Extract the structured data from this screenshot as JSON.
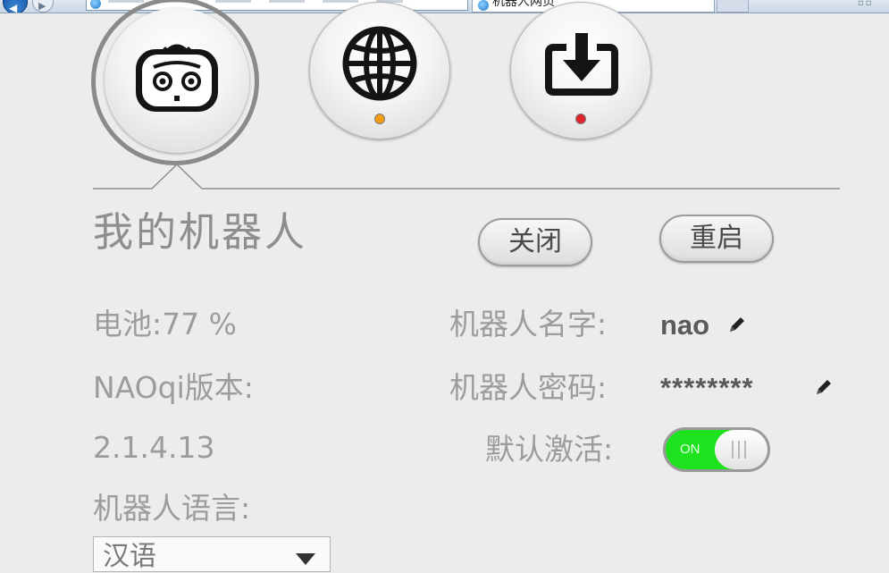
{
  "browser": {
    "tab_title": "机器人网页"
  },
  "nav": {
    "robot": {
      "icon": "robot-face-icon",
      "selected": true
    },
    "network": {
      "icon": "globe-icon",
      "status_color": "#f39c12"
    },
    "update": {
      "icon": "download-icon",
      "status_color": "#e0242a"
    }
  },
  "page": {
    "title": "我的机器人",
    "shutdown_label": "关闭",
    "restart_label": "重启"
  },
  "info": {
    "battery_label": "电池:",
    "battery_value": "77 %",
    "naoqi_label": "NAOqi版本:",
    "naoqi_value": "2.1.4.13",
    "language_label": "机器人语言:",
    "language_value": "汉语"
  },
  "settings": {
    "name_label": "机器人名字:",
    "name_value": "nao",
    "password_label": "机器人密码:",
    "password_value": "********",
    "autostart_label": "默认激活:",
    "autostart_state": "ON"
  },
  "colors": {
    "toggle_on": "#1ee21e",
    "label_gray": "#9c9c9c"
  }
}
